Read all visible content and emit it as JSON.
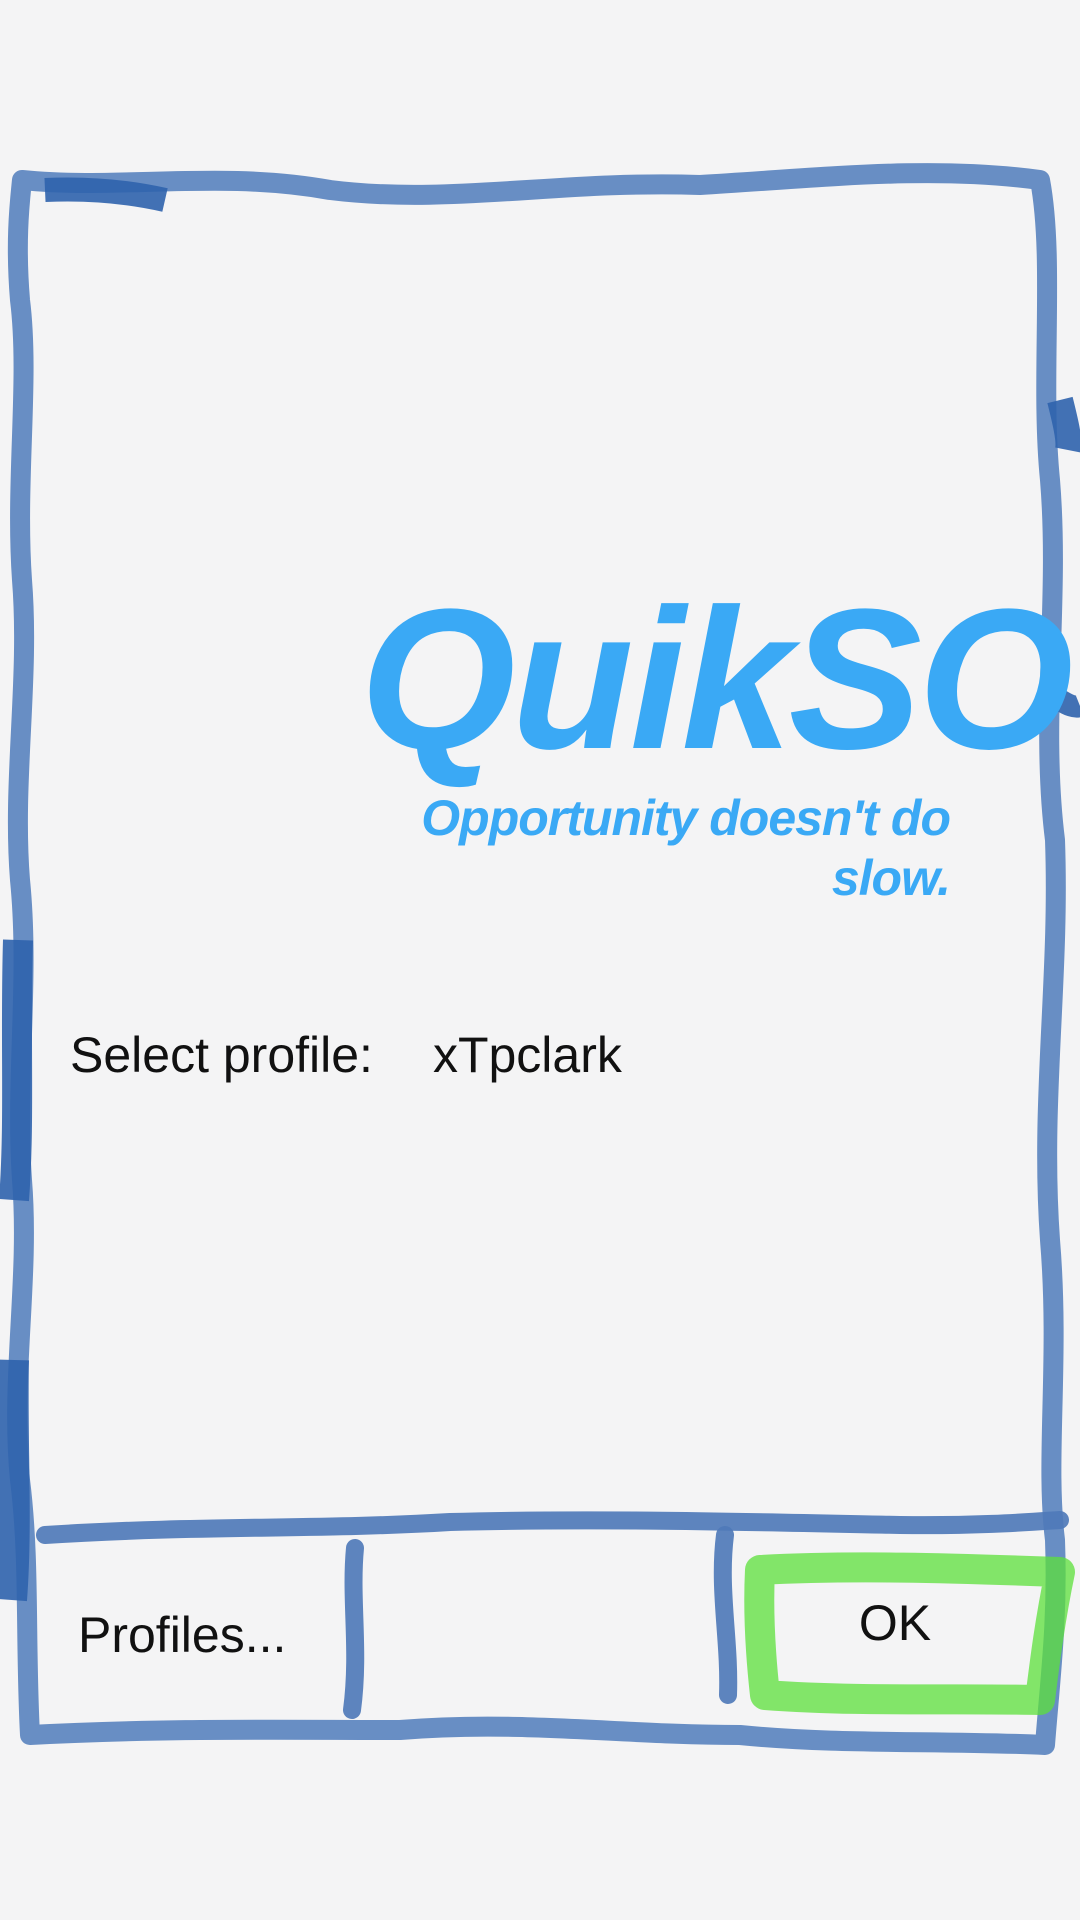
{
  "logo": {
    "title": "QuikSO",
    "tagline": "Opportunity doesn't do slow."
  },
  "profile": {
    "label": "Select profile:",
    "value": "xTpclark"
  },
  "buttons": {
    "profiles_label": "Profiles...",
    "ok_label": "OK"
  },
  "colors": {
    "background": "#f4f4f5",
    "brand_blue": "#3aa9f5",
    "sketch_frame": "#5b84bf",
    "highlight_green": "#5ce03a"
  }
}
